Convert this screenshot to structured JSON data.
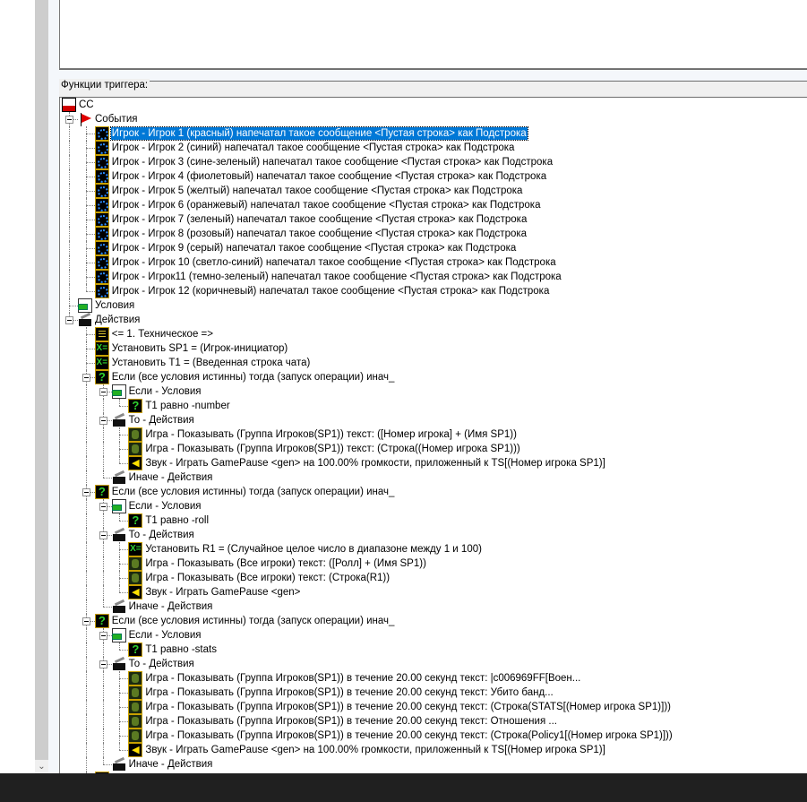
{
  "group_label": "Функции триггера:",
  "colors": {
    "selection": "#0078d7",
    "taskbar": "#202020"
  },
  "tree": [
    {
      "level": 0,
      "icon": "doc",
      "label": "CC"
    },
    {
      "level": 1,
      "icon": "flag",
      "label": "События",
      "expanded": true
    },
    {
      "level": 2,
      "icon": "event",
      "label": "Игрок - Игрок 1 (красный) напечатал такое сообщение <Пустая строка> как Подстрока",
      "selected": true
    },
    {
      "level": 2,
      "icon": "event",
      "label": "Игрок - Игрок 2 (синий) напечатал такое сообщение <Пустая строка> как Подстрока"
    },
    {
      "level": 2,
      "icon": "event",
      "label": "Игрок - Игрок 3 (сине-зеленый) напечатал такое сообщение <Пустая строка> как Подстрока"
    },
    {
      "level": 2,
      "icon": "event",
      "label": "Игрок - Игрок 4 (фиолетовый) напечатал такое сообщение <Пустая строка> как Подстрока"
    },
    {
      "level": 2,
      "icon": "event",
      "label": "Игрок - Игрок 5 (желтый) напечатал такое сообщение <Пустая строка> как Подстрока"
    },
    {
      "level": 2,
      "icon": "event",
      "label": "Игрок - Игрок 6 (оранжевый) напечатал такое сообщение <Пустая строка> как Подстрока"
    },
    {
      "level": 2,
      "icon": "event",
      "label": "Игрок - Игрок 7 (зеленый) напечатал такое сообщение <Пустая строка> как Подстрока"
    },
    {
      "level": 2,
      "icon": "event",
      "label": "Игрок - Игрок 8 (розовый) напечатал такое сообщение <Пустая строка> как Подстрока"
    },
    {
      "level": 2,
      "icon": "event",
      "label": "Игрок - Игрок 9 (серый) напечатал такое сообщение <Пустая строка> как Подстрока"
    },
    {
      "level": 2,
      "icon": "event",
      "label": "Игрок - Игрок 10 (светло-синий) напечатал такое сообщение <Пустая строка> как Подстрока"
    },
    {
      "level": 2,
      "icon": "event",
      "label": "Игрок - Игрок11 (темно-зеленый) напечатал такое сообщение <Пустая строка> как Подстрока"
    },
    {
      "level": 2,
      "icon": "event",
      "label": "Игрок - Игрок 12 (коричневый) напечатал такое сообщение <Пустая строка> как Подстрока"
    },
    {
      "level": 1,
      "icon": "cond",
      "label": "Условия"
    },
    {
      "level": 1,
      "icon": "clap",
      "label": "Действия",
      "expanded": true
    },
    {
      "level": 2,
      "icon": "comment",
      "label": "<= 1. Техническое =>"
    },
    {
      "level": 2,
      "icon": "set",
      "label": "Установить SP1 = (Игрок-инициатор)"
    },
    {
      "level": 2,
      "icon": "set",
      "label": "Установить T1 = (Введенная строка чата)"
    },
    {
      "level": 2,
      "icon": "q",
      "label": "Если (все условия истинны) тогда (запуск операции) инач_",
      "expanded": true
    },
    {
      "level": 3,
      "icon": "cond",
      "label": "Если - Условия",
      "expanded": true
    },
    {
      "level": 4,
      "icon": "q",
      "label": "T1 равно -number"
    },
    {
      "level": 3,
      "icon": "clap",
      "label": "То - Действия",
      "expanded": true
    },
    {
      "level": 4,
      "icon": "game",
      "label": "Игра - Показывать (Группа Игроков(SP1)) текст: ([Номер игрока]  + (Имя SP1))"
    },
    {
      "level": 4,
      "icon": "game",
      "label": "Игра - Показывать (Группа Игроков(SP1)) текст: (Строка((Номер игрока SP1)))"
    },
    {
      "level": 4,
      "icon": "sound",
      "label": "Звук - Играть GamePause <gen> на 100.00% громкости, приложенный к TS[(Номер игрока SP1)]"
    },
    {
      "level": 3,
      "icon": "clap",
      "label": "Иначе - Действия"
    },
    {
      "level": 2,
      "icon": "q",
      "label": "Если (все условия истинны) тогда (запуск операции) инач_",
      "expanded": true
    },
    {
      "level": 3,
      "icon": "cond",
      "label": "Если - Условия",
      "expanded": true
    },
    {
      "level": 4,
      "icon": "q",
      "label": "T1 равно -roll"
    },
    {
      "level": 3,
      "icon": "clap",
      "label": "То - Действия",
      "expanded": true
    },
    {
      "level": 4,
      "icon": "set",
      "label": "Установить R1 = (Случайное целое число в диапазоне между 1 и 100)"
    },
    {
      "level": 4,
      "icon": "game",
      "label": "Игра - Показывать (Все игроки) текст: ([Ролл]  + (Имя SP1))"
    },
    {
      "level": 4,
      "icon": "game",
      "label": "Игра - Показывать (Все игроки) текст: (Строка(R1))"
    },
    {
      "level": 4,
      "icon": "sound",
      "label": "Звук - Играть GamePause <gen>"
    },
    {
      "level": 3,
      "icon": "clap",
      "label": "Иначе - Действия"
    },
    {
      "level": 2,
      "icon": "q",
      "label": "Если (все условия истинны) тогда (запуск операции) инач_",
      "expanded": true
    },
    {
      "level": 3,
      "icon": "cond",
      "label": "Если - Условия",
      "expanded": true
    },
    {
      "level": 4,
      "icon": "q",
      "label": "T1 равно -stats"
    },
    {
      "level": 3,
      "icon": "clap",
      "label": "То - Действия",
      "expanded": true
    },
    {
      "level": 4,
      "icon": "game",
      "label": "Игра - Показывать (Группа Игроков(SP1)) в течение 20.00 секунд текст: |c006969FF[Воен..."
    },
    {
      "level": 4,
      "icon": "game",
      "label": "Игра - Показывать (Группа Игроков(SP1)) в течение 20.00 секунд текст: Убито банд..."
    },
    {
      "level": 4,
      "icon": "game",
      "label": "Игра - Показывать (Группа Игроков(SP1)) в течение 20.00 секунд текст: (Строка(STATS[(Номер игрока SP1)]))"
    },
    {
      "level": 4,
      "icon": "game",
      "label": "Игра - Показывать (Группа Игроков(SP1)) в течение 20.00 секунд текст: Отношения ..."
    },
    {
      "level": 4,
      "icon": "game",
      "label": "Игра - Показывать (Группа Игроков(SP1)) в течение 20.00 секунд текст: (Строка(Policy1[(Номер игрока SP1)]))"
    },
    {
      "level": 4,
      "icon": "sound",
      "label": "Звук - Играть GamePause <gen> на 100.00% громкости, приложенный к TS[(Номер игрока SP1)]"
    },
    {
      "level": 3,
      "icon": "clap",
      "label": "Иначе - Действия"
    },
    {
      "level": 2,
      "icon": "q",
      "label": ""
    }
  ]
}
